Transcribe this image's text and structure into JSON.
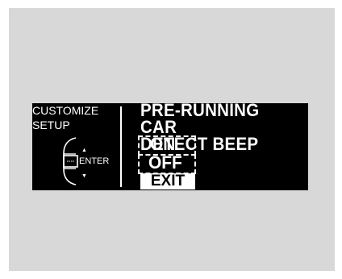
{
  "screen": {
    "left_title": "CUSTOMIZE\nSETUP",
    "right_title": "PRE-RUNNING CAR\nDETECT BEEP",
    "options": [
      "ON",
      "OFF"
    ],
    "exit_label": "EXIT"
  },
  "selector": {
    "enter_label": "ENTER",
    "up_icon": "up-arrow-icon",
    "down_icon": "down-arrow-icon",
    "dial_icon": "selector-knob-icon"
  },
  "colors": {
    "screen_bg": "#000000",
    "text": "#ffffff",
    "panel_bg": "#d8d8d8"
  }
}
